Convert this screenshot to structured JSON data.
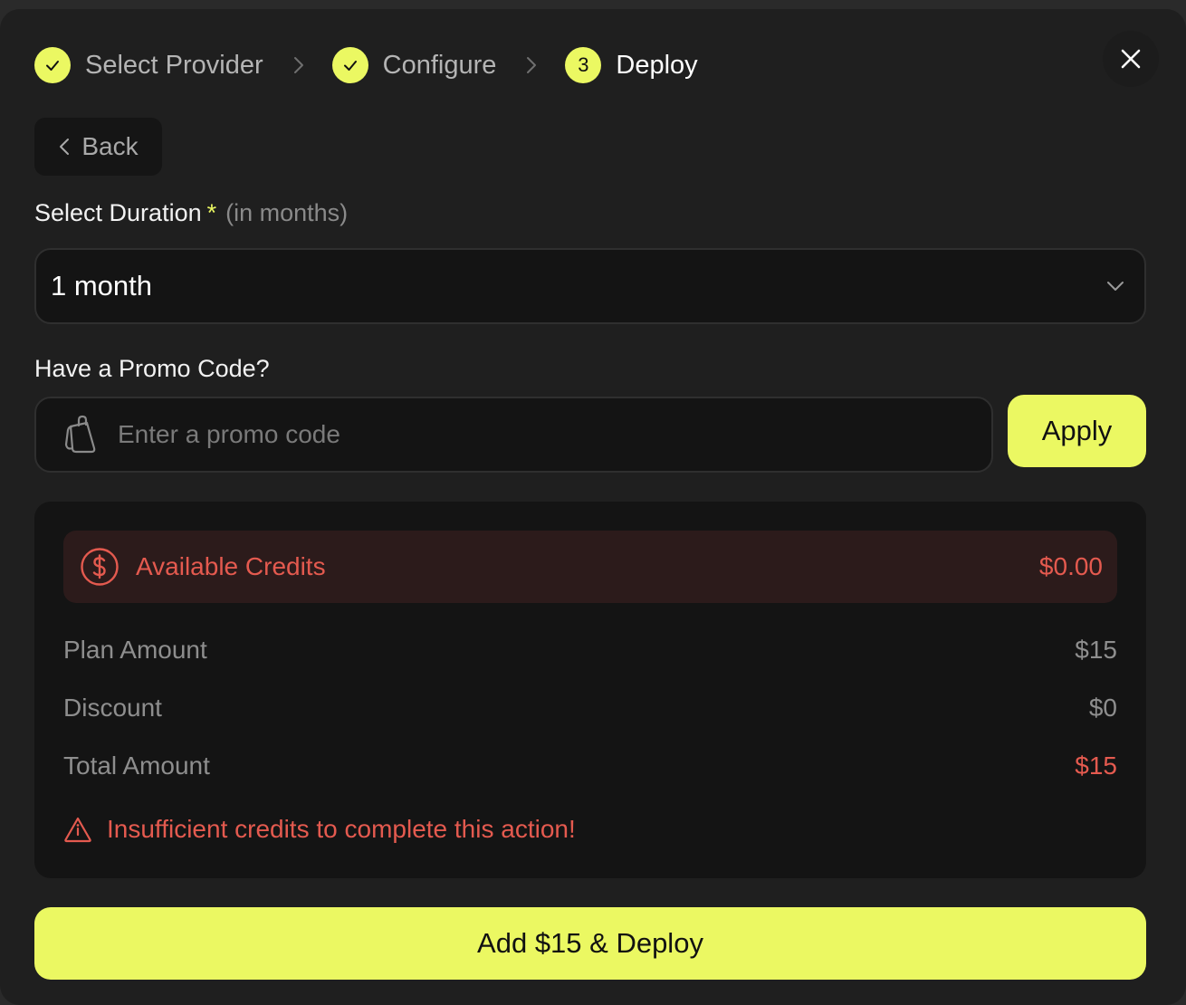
{
  "stepper": {
    "steps": [
      {
        "label": "Select Provider",
        "status": "done"
      },
      {
        "label": "Configure",
        "status": "done"
      },
      {
        "label": "Deploy",
        "status": "active",
        "number": "3"
      }
    ]
  },
  "back": {
    "label": "Back"
  },
  "duration": {
    "label": "Select Duration",
    "required_mark": "*",
    "hint": "(in months)",
    "selected": "1 month"
  },
  "promo": {
    "label": "Have a Promo Code?",
    "placeholder": "Enter a promo code",
    "value": "",
    "apply_label": "Apply"
  },
  "summary": {
    "credits_label": "Available Credits",
    "credits_value": "$0.00",
    "rows": [
      {
        "label": "Plan Amount",
        "value": "$15"
      },
      {
        "label": "Discount",
        "value": "$0"
      },
      {
        "label": "Total Amount",
        "value": "$15"
      }
    ],
    "warning": "Insufficient credits to complete this action!"
  },
  "deploy_button": {
    "label": "Add $15 & Deploy"
  },
  "colors": {
    "accent": "#ebf862",
    "danger": "#e45a4f",
    "background": "#1f1f1f"
  }
}
